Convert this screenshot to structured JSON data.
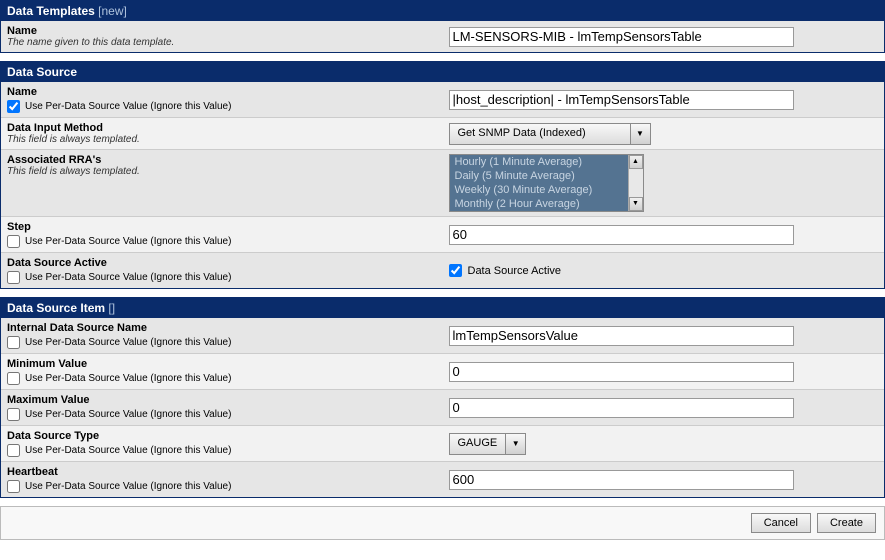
{
  "common": {
    "use_per_ds": "Use Per-Data Source Value (Ignore this Value)",
    "templated": "This field is always templated."
  },
  "sections": {
    "dataTemplates": {
      "title": "Data Templates",
      "tag_open": "[",
      "tag_text": "new",
      "tag_close": "]",
      "name": {
        "label": "Name",
        "desc": "The name given to this data template.",
        "value": "LM-SENSORS-MIB - lmTempSensorsTable"
      }
    },
    "dataSource": {
      "title": "Data Source",
      "name": {
        "label": "Name",
        "checked": true,
        "value": "|host_description| - lmTempSensorsTable"
      },
      "inputMethod": {
        "label": "Data Input Method",
        "value": "Get SNMP Data (Indexed)"
      },
      "rra": {
        "label": "Associated RRA's",
        "options": [
          "Hourly (1 Minute Average)",
          "Daily (5 Minute Average)",
          "Weekly (30 Minute Average)",
          "Monthly (2 Hour Average)"
        ]
      },
      "step": {
        "label": "Step",
        "checked": false,
        "value": "60"
      },
      "active": {
        "label": "Data Source Active",
        "sub_checked": false,
        "right_checked": true,
        "right_label": "Data Source Active"
      }
    },
    "dataSourceItem": {
      "title": "Data Source Item",
      "tag_open": "[",
      "tag_close": "]",
      "internalName": {
        "label": "Internal Data Source Name",
        "checked": false,
        "value": "lmTempSensorsValue"
      },
      "minValue": {
        "label": "Minimum Value",
        "checked": false,
        "value": "0"
      },
      "maxValue": {
        "label": "Maximum Value",
        "checked": false,
        "value": "0"
      },
      "dsType": {
        "label": "Data Source Type",
        "checked": false,
        "value": "GAUGE"
      },
      "heartbeat": {
        "label": "Heartbeat",
        "checked": false,
        "value": "600"
      }
    }
  },
  "footer": {
    "cancel": "Cancel",
    "create": "Create"
  }
}
